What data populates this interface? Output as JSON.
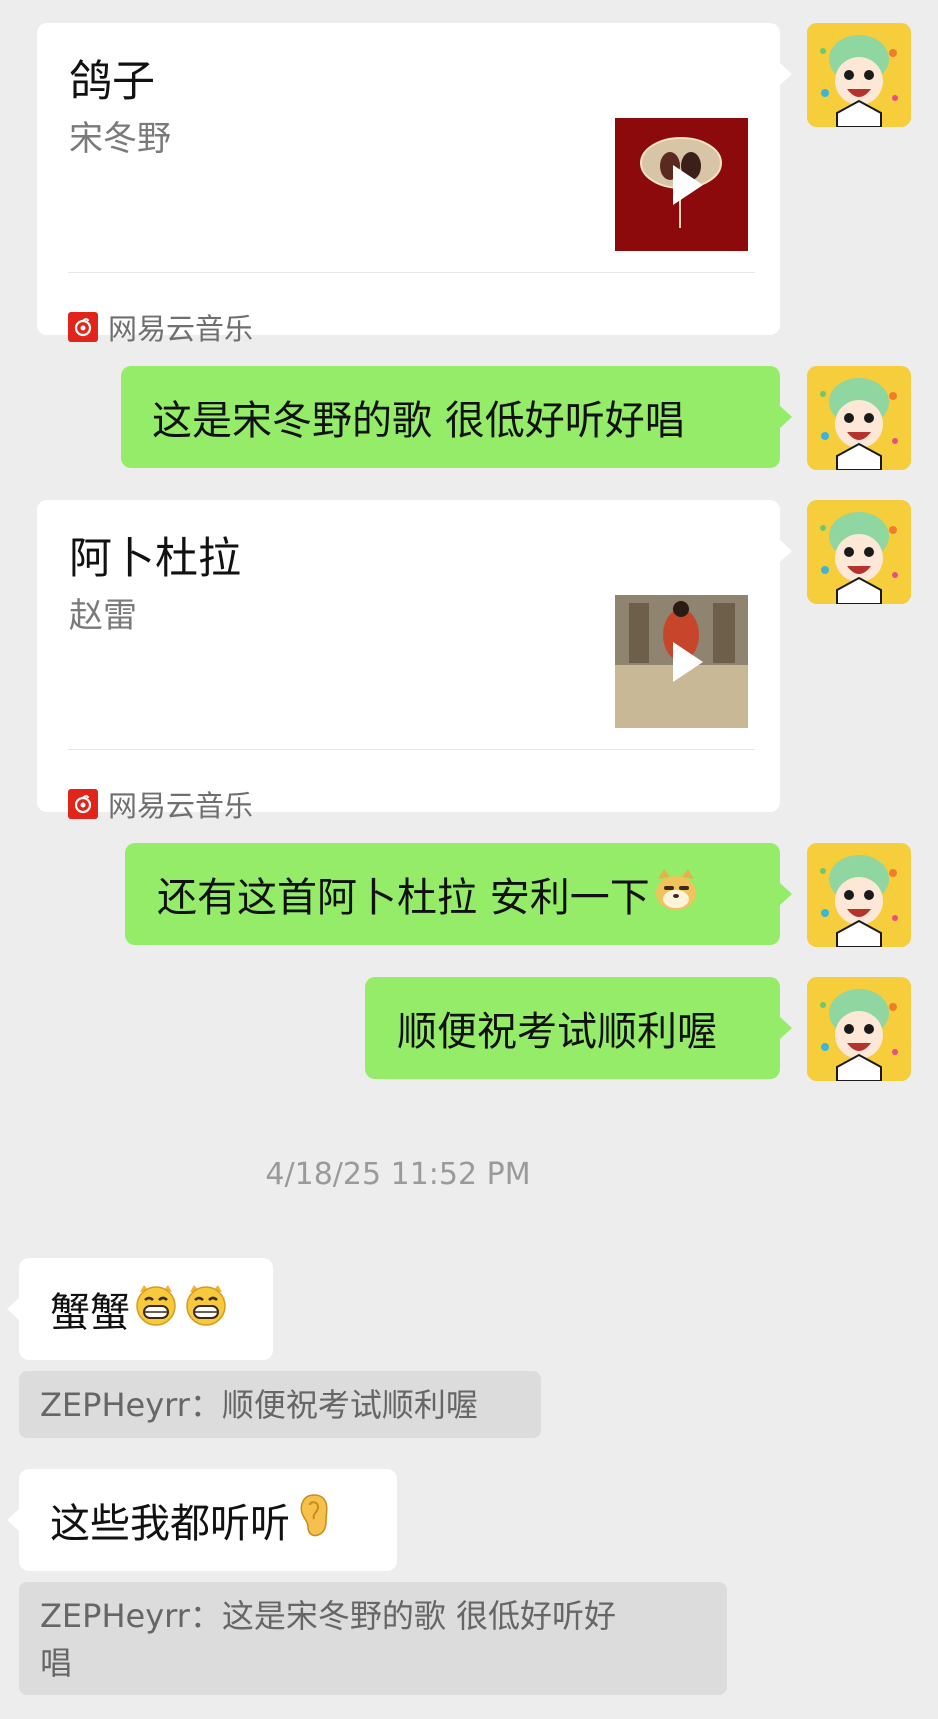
{
  "messages": [
    {
      "type": "music_card",
      "title": "鸽子",
      "artist": "宋冬野",
      "source": "网易云音乐"
    },
    {
      "type": "text",
      "text": "这是宋冬野的歌 很低好听好唱"
    },
    {
      "type": "music_card",
      "title": "阿卜杜拉",
      "artist": "赵雷",
      "source": "网易云音乐"
    },
    {
      "type": "text",
      "text": "还有这首阿卜杜拉 安利一下"
    },
    {
      "type": "text",
      "text": "顺便祝考试顺利喔"
    }
  ],
  "timestamp": "4/18/25 11:52 PM",
  "received": [
    {
      "text": "蟹蟹",
      "quote": "ZEPHeyrr：顺便祝考试顺利喔"
    },
    {
      "text": "这些我都听听",
      "quote_line1": "ZEPHeyrr：这是宋冬野的歌 很低好听好",
      "quote_line2": "唱"
    }
  ],
  "colors": {
    "sent_bubble": "#95ec69",
    "background": "#ededed",
    "netease_red": "#e1251b"
  },
  "icons": [
    "play-icon",
    "netease-music-icon",
    "doge-emoji",
    "grin-emoji",
    "ear-emoji",
    "avatar"
  ]
}
